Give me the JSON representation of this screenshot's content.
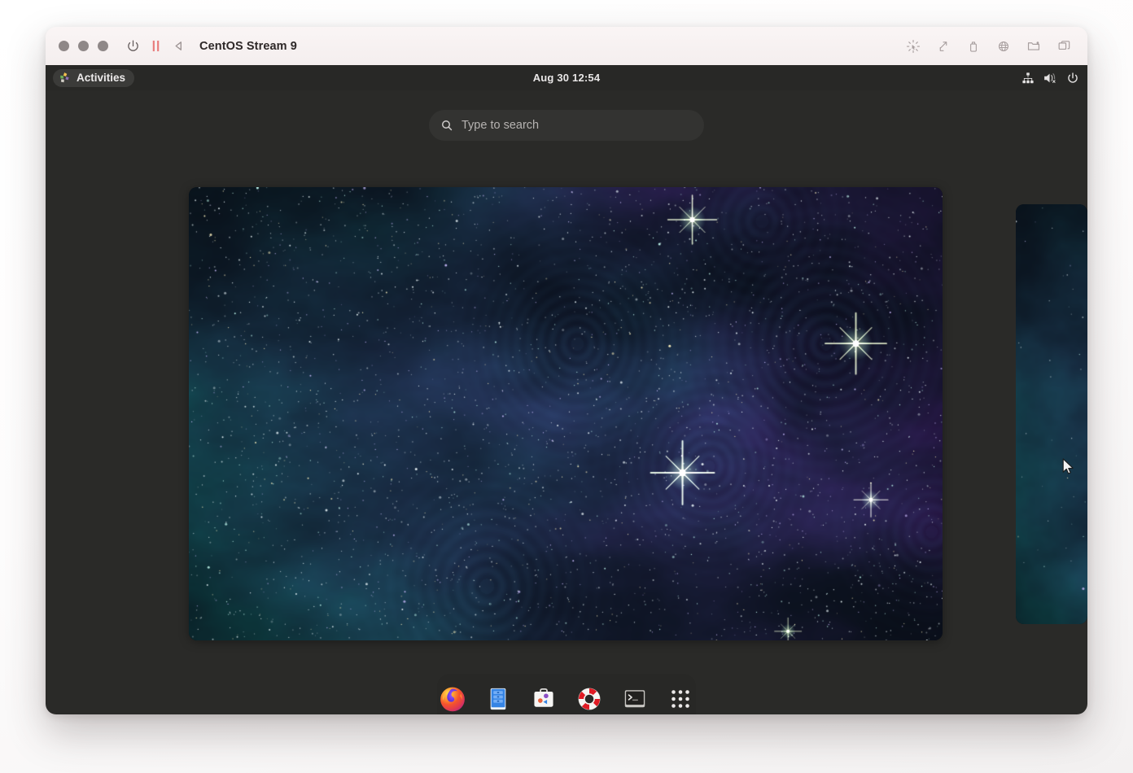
{
  "window": {
    "title": "CentOS Stream 9",
    "traffic_lights": [
      "close",
      "minimize",
      "maximize"
    ],
    "left_controls": [
      {
        "name": "power-icon",
        "label": "Power"
      },
      {
        "name": "pause-icon",
        "label": "Pause"
      },
      {
        "name": "back-icon",
        "label": "Back"
      }
    ],
    "right_controls": [
      {
        "name": "cursor-click-icon",
        "label": "Input capture"
      },
      {
        "name": "resize-arrow-icon",
        "label": "Resize"
      },
      {
        "name": "usb-icon",
        "label": "USB devices"
      },
      {
        "name": "network-globe-icon",
        "label": "Network"
      },
      {
        "name": "shared-folder-icon",
        "label": "Shared folders"
      },
      {
        "name": "windows-stack-icon",
        "label": "Windows"
      }
    ]
  },
  "desktop": {
    "topbar": {
      "activities_label": "Activities",
      "clock": "Aug 30  12:54",
      "clock_date": "Aug 30",
      "clock_time": "12:54",
      "tray": [
        {
          "name": "network-wired-icon",
          "label": "Wired network"
        },
        {
          "name": "volume-muted-icon",
          "label": "Volume muted"
        },
        {
          "name": "power-menu-icon",
          "label": "System menu"
        }
      ]
    },
    "search": {
      "placeholder": "Type to search",
      "value": "",
      "icon": "search-icon"
    },
    "overview": {
      "workspace_count": 2,
      "active_workspace": 1,
      "wallpaper_name": "cosmic-ripples-nebula"
    },
    "dock": {
      "items": [
        {
          "name": "dock-item-firefox",
          "label": "Firefox",
          "icon": "firefox-icon"
        },
        {
          "name": "dock-item-files",
          "label": "Files",
          "icon": "files-cabinet-icon"
        },
        {
          "name": "dock-item-software",
          "label": "Software",
          "icon": "software-bag-icon"
        },
        {
          "name": "dock-item-help",
          "label": "Help",
          "icon": "lifering-icon"
        },
        {
          "name": "dock-item-terminal",
          "label": "Terminal",
          "icon": "terminal-icon"
        },
        {
          "name": "dock-item-show-apps",
          "label": "Show Applications",
          "icon": "apps-grid-icon"
        }
      ]
    }
  },
  "colors": {
    "page_bg": "#fdfcfc",
    "titlebar_bg": "#f7f2f2",
    "desktop_bg": "#2a2a28",
    "topbar_bg": "#282826",
    "dock_bg": "#282826",
    "search_bg": "#333331",
    "accent_red": "#e87c7c",
    "text_light": "#eceaea",
    "wallpaper_teal": "#0d6360",
    "wallpaper_purple": "#3b1a56",
    "wallpaper_deep": "#060b14"
  }
}
